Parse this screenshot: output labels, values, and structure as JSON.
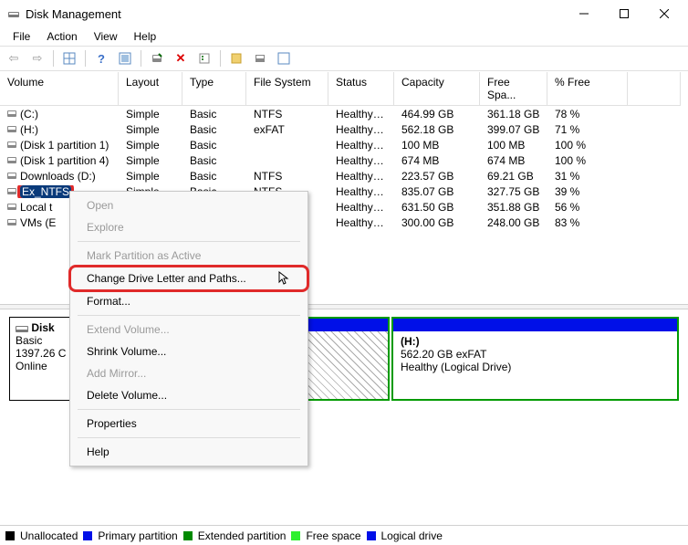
{
  "window": {
    "title": "Disk Management"
  },
  "menubar": [
    "File",
    "Action",
    "View",
    "Help"
  ],
  "columns": [
    "Volume",
    "Layout",
    "Type",
    "File System",
    "Status",
    "Capacity",
    "Free Spa...",
    "% Free"
  ],
  "volumes": [
    {
      "name": "(C:)",
      "layout": "Simple",
      "type": "Basic",
      "fs": "NTFS",
      "status": "Healthy (B...",
      "capacity": "464.99 GB",
      "free": "361.18 GB",
      "pct": "78 %"
    },
    {
      "name": "(H:)",
      "layout": "Simple",
      "type": "Basic",
      "fs": "exFAT",
      "status": "Healthy (L...",
      "capacity": "562.18 GB",
      "free": "399.07 GB",
      "pct": "71 %"
    },
    {
      "name": "(Disk 1 partition 1)",
      "layout": "Simple",
      "type": "Basic",
      "fs": "",
      "status": "Healthy (E...",
      "capacity": "100 MB",
      "free": "100 MB",
      "pct": "100 %"
    },
    {
      "name": "(Disk 1 partition 4)",
      "layout": "Simple",
      "type": "Basic",
      "fs": "",
      "status": "Healthy (R...",
      "capacity": "674 MB",
      "free": "674 MB",
      "pct": "100 %"
    },
    {
      "name": "Downloads (D:)",
      "layout": "Simple",
      "type": "Basic",
      "fs": "NTFS",
      "status": "Healthy (B...",
      "capacity": "223.57 GB",
      "free": "69.21 GB",
      "pct": "31 %"
    },
    {
      "name": "Ex_NTFS",
      "layout": "Simple",
      "type": "Basic",
      "fs": "NTFS",
      "status": "Healthy (B...",
      "capacity": "835.07 GB",
      "free": "327.75 GB",
      "pct": "39 %"
    },
    {
      "name": "Local t",
      "layout": "",
      "type": "",
      "fs": "",
      "status": "Healthy (B...",
      "capacity": "631.50 GB",
      "free": "351.88 GB",
      "pct": "56 %"
    },
    {
      "name": "VMs (E",
      "layout": "",
      "type": "",
      "fs": "",
      "status": "Healthy (B...",
      "capacity": "300.00 GB",
      "free": "248.00 GB",
      "pct": "83 %"
    }
  ],
  "selected_index": 5,
  "ctxmenu": {
    "open": "Open",
    "explore": "Explore",
    "mark_active": "Mark Partition as Active",
    "change_letter": "Change Drive Letter and Paths...",
    "format": "Format...",
    "extend": "Extend Volume...",
    "shrink": "Shrink Volume...",
    "add_mirror": "Add Mirror...",
    "delete": "Delete Volume...",
    "properties": "Properties",
    "help": "Help"
  },
  "disk": {
    "label": "Disk",
    "type": "Basic",
    "size": "1397.26 C",
    "status": "Online"
  },
  "partition": {
    "letter": "(H:)",
    "info": "562.20 GB exFAT",
    "status": "Healthy (Logical Drive)"
  },
  "legend": {
    "unallocated": "Unallocated",
    "primary": "Primary partition",
    "extended": "Extended partition",
    "free": "Free space",
    "logical": "Logical drive"
  }
}
